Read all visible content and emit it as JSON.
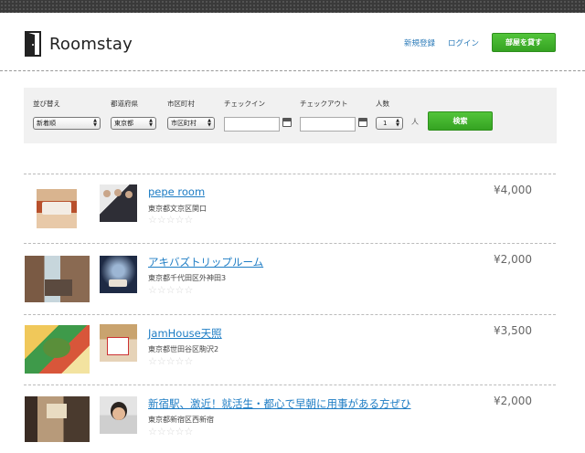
{
  "app": {
    "name": "Roomstay"
  },
  "nav": {
    "signup": "新規登録",
    "login": "ログイン",
    "lend_room": "部屋を貸す"
  },
  "search": {
    "sort": {
      "label": "並び替え",
      "value": "新着順"
    },
    "prefecture": {
      "label": "都道府県",
      "value": "東京都"
    },
    "city": {
      "label": "市区町村",
      "value": "市区町村"
    },
    "checkin": {
      "label": "チェックイン"
    },
    "checkout": {
      "label": "チェックアウト"
    },
    "guests": {
      "label": "人数",
      "value": "1",
      "unit": "人"
    },
    "submit": "検索"
  },
  "listings": [
    {
      "title": "pepe room",
      "address": "東京都文京区関口",
      "price": "¥4,000",
      "rating": "☆☆☆☆☆"
    },
    {
      "title": "アキバズトリップルーム",
      "address": "東京都千代田区外神田3",
      "price": "¥2,000",
      "rating": "☆☆☆☆☆"
    },
    {
      "title": "JamHouse天照",
      "address": "東京都世田谷区駒沢2",
      "price": "¥3,500",
      "rating": "☆☆☆☆☆"
    },
    {
      "title": "新宿駅、激近！就活生・都心で早朝に用事がある方ぜひ",
      "address": "東京都新宿区西新宿",
      "price": "¥2,000",
      "rating": "☆☆☆☆☆"
    }
  ],
  "colors": {
    "accent_green": "#3cb22a",
    "link_blue": "#1d7cc4"
  }
}
